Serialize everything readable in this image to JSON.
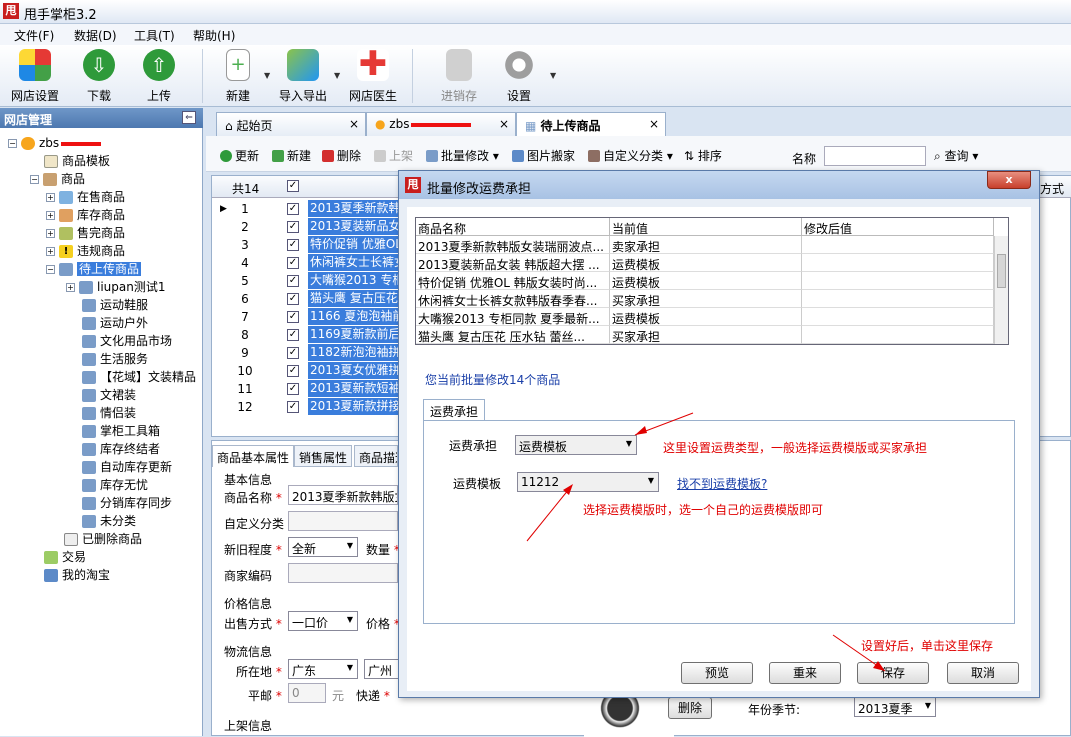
{
  "window": {
    "title": "甩手掌柜3.2",
    "logo_text": "甩"
  },
  "menu": [
    "文件(F)",
    "数据(D)",
    "工具(T)",
    "帮助(H)"
  ],
  "toolbar": [
    {
      "label": "网店设置",
      "icon": "apps-icon",
      "color": "#e03c31"
    },
    {
      "label": "下载",
      "icon": "download-icon",
      "color": "#2e9a3a"
    },
    {
      "label": "上传",
      "icon": "upload-icon",
      "color": "#2e9a3a"
    },
    {
      "label": "新建",
      "icon": "new-icon",
      "color": "#8bc34a"
    },
    {
      "label": "导入导出",
      "icon": "import-export-icon",
      "color": "#4caf50"
    },
    {
      "label": "网店医生",
      "icon": "doctor-icon",
      "color": "#e53935"
    },
    {
      "label": "进销存",
      "icon": "inventory-icon",
      "color": "#9e9e9e"
    },
    {
      "label": "设置",
      "icon": "gear-icon",
      "color": "#9e9e9e"
    }
  ],
  "left": {
    "header": "网店管理",
    "pin_glyph": "⇐",
    "account": "zbs",
    "items": [
      {
        "label": "商品模板"
      },
      {
        "label": "商品"
      },
      {
        "label": "在售商品"
      },
      {
        "label": "库存商品"
      },
      {
        "label": "售完商品"
      },
      {
        "label": "违规商品"
      },
      {
        "label": "待上传商品"
      },
      {
        "label": "liupan测试1"
      },
      {
        "label": "运动鞋服"
      },
      {
        "label": "运动户外"
      },
      {
        "label": "文化用品市场"
      },
      {
        "label": "生活服务"
      },
      {
        "label": "【花域】文装精品"
      },
      {
        "label": "文裙装"
      },
      {
        "label": "情侣装"
      },
      {
        "label": "掌柜工具箱"
      },
      {
        "label": "库存终结者"
      },
      {
        "label": "自动库存更新"
      },
      {
        "label": "库存无忧"
      },
      {
        "label": "分销库存同步"
      },
      {
        "label": "未分类"
      },
      {
        "label": "已删除商品"
      },
      {
        "label": "交易"
      },
      {
        "label": "我的淘宝"
      }
    ]
  },
  "tabs": [
    {
      "label": "起始页"
    },
    {
      "label": "zbs"
    },
    {
      "label": "待上传商品"
    }
  ],
  "subtoolbar": {
    "refresh": "更新",
    "new": "新建",
    "delete": "删除",
    "shelve": "上架",
    "batch_edit": "批量修改",
    "image_move": "图片搬家",
    "custom_category": "自定义分类",
    "sort": "排序",
    "name_label": "名称",
    "query": "查询"
  },
  "grid": {
    "total": "共14",
    "right_col": "方式",
    "rows": [
      {
        "n": "1",
        "text": "2013夏季新款韩版"
      },
      {
        "n": "2",
        "text": "2013夏装新品女装"
      },
      {
        "n": "3",
        "text": "特价促销 优雅OL"
      },
      {
        "n": "4",
        "text": "休闲裤女士长裤女"
      },
      {
        "n": "5",
        "text": "大嘴猴2013 专柜"
      },
      {
        "n": "6",
        "text": "猫头鹰 复古压花"
      },
      {
        "n": "7",
        "text": "1166 夏泡泡袖前"
      },
      {
        "n": "8",
        "text": "1169夏新款前后打"
      },
      {
        "n": "9",
        "text": "1182新泡泡袖拼接"
      },
      {
        "n": "10",
        "text": "2013夏女优雅拼接"
      },
      {
        "n": "11",
        "text": "2013夏新款短袖"
      },
      {
        "n": "12",
        "text": "2013夏新款拼接"
      }
    ]
  },
  "bottom": {
    "tabs": [
      "商品基本属性",
      "销售属性",
      "商品描述"
    ],
    "basic_info": "基本信息",
    "product_name_label": "商品名称",
    "product_name_value": "2013夏季新款韩版女",
    "custom_category_label": "自定义分类",
    "condition_label": "新旧程度",
    "condition_value": "全新",
    "quantity_label": "数量",
    "merchant_code_label": "商家编码",
    "price_info": "价格信息",
    "sale_method_label": "出售方式",
    "sale_method_value": "一口价",
    "price_label": "价格",
    "logistics_info": "物流信息",
    "location_label": "所在地",
    "province": "广东",
    "city": "广州",
    "flat_mail_label": "平邮",
    "flat_mail_value": "0",
    "yuan": "元",
    "express_label": "快递",
    "shelf_info": "上架信息",
    "delete_btn": "删除",
    "season_label": "年份季节:",
    "season_value": "2013夏季"
  },
  "dialog": {
    "title": "批量修改运费承担",
    "close": "x",
    "columns": [
      "商品名称",
      "当前值",
      "修改后值"
    ],
    "rows": [
      {
        "name": "2013夏季新款韩版女装瑞丽波点...",
        "current": "卖家承担"
      },
      {
        "name": "2013夏装新品女装 韩版超大摆 ...",
        "current": "运费模板"
      },
      {
        "name": "特价促销 优雅OL 韩版女装时尚...",
        "current": "运费模板"
      },
      {
        "name": "休闲裤女士长裤女款韩版春季春...",
        "current": "买家承担"
      },
      {
        "name": "大嘴猴2013 专柜同款 夏季最新...",
        "current": "运费模板"
      },
      {
        "name": "猫头鹰 复古压花 压水钻 蕾丝...",
        "current": "买家承担"
      }
    ],
    "summary": "您当前批量修改14个商品",
    "section_tab": "运费承担",
    "bearer_label": "运费承担",
    "bearer_value": "运费模板",
    "template_label": "运费模板",
    "template_value": "11212",
    "template_link": "找不到运费模板?",
    "buttons": {
      "preview": "预览",
      "reset": "重来",
      "save": "保存",
      "cancel": "取消"
    },
    "annotations": {
      "a1": "这里设置运费类型，一般选择运费模版或买家承担",
      "a2": "选择运费模版时，选一个自己的运费模版即可",
      "a3": "设置好后，单击这里保存"
    }
  }
}
